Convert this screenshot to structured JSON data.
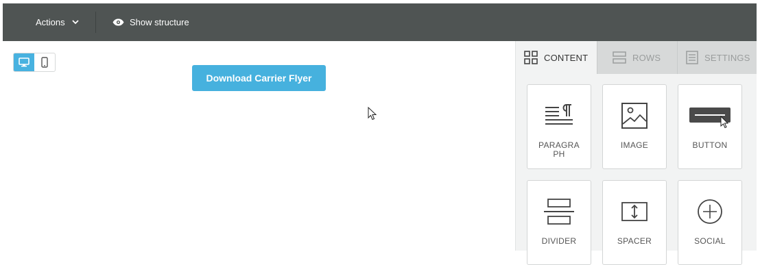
{
  "topbar": {
    "actions_label": "Actions",
    "show_structure_label": "Show structure"
  },
  "view_toggle": {
    "options": [
      "desktop",
      "mobile"
    ],
    "selected": "desktop"
  },
  "canvas": {
    "button_label": "Download Carrier Flyer",
    "button_color": "#46b1de"
  },
  "panel": {
    "tabs": [
      {
        "label": "CONTENT",
        "icon": "grid-icon",
        "active": true
      },
      {
        "label": "ROWS",
        "icon": "rows-icon",
        "active": false
      },
      {
        "label": "SETTINGS",
        "icon": "settings-icon",
        "active": false
      }
    ],
    "blocks": [
      {
        "label": "PARAGRAPH",
        "icon": "paragraph-icon"
      },
      {
        "label": "IMAGE",
        "icon": "image-icon"
      },
      {
        "label": "BUTTON",
        "icon": "button-icon"
      },
      {
        "label": "DIVIDER",
        "icon": "divider-icon"
      },
      {
        "label": "SPACER",
        "icon": "spacer-icon"
      },
      {
        "label": "SOCIAL",
        "icon": "social-icon"
      }
    ]
  },
  "colors": {
    "topbar": "#4f5453",
    "accent": "#48b2e0",
    "panel_bg": "#f2f3f3"
  }
}
